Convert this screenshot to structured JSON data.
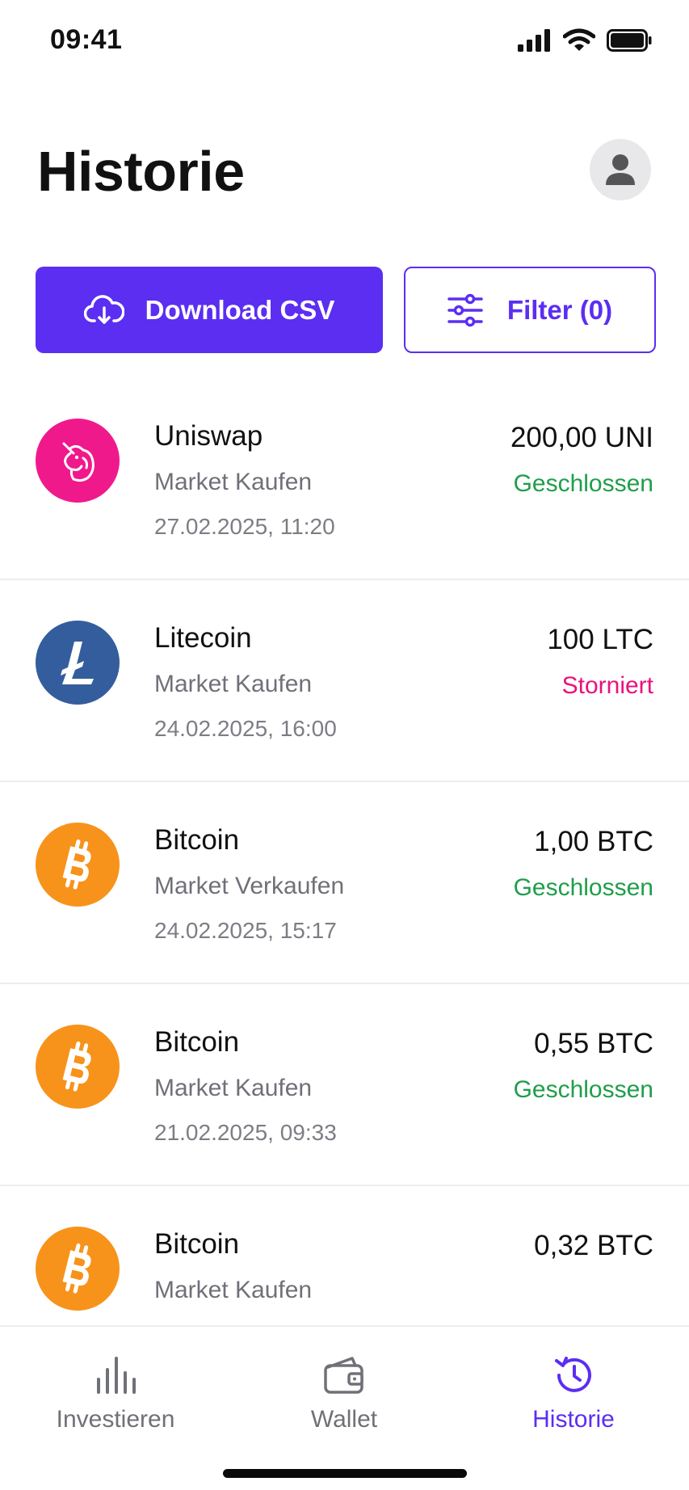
{
  "status_bar": {
    "time": "09:41"
  },
  "header": {
    "title": "Historie"
  },
  "actions": {
    "download_label": "Download CSV",
    "filter_label": "Filter (0)"
  },
  "colors": {
    "accent": "#5b2ef2",
    "status_closed": "#1f9e4a",
    "status_cancelled": "#e8127c",
    "uniswap": "#f0198c",
    "litecoin": "#345d9d",
    "bitcoin": "#f7931a"
  },
  "transactions": [
    {
      "coin": "uniswap",
      "icon": "uniswap-icon",
      "name": "Uniswap",
      "type": "Market Kaufen",
      "date": "27.02.2025, 11:20",
      "amount": "200,00 UNI",
      "status": "Geschlossen",
      "status_kind": "closed"
    },
    {
      "coin": "litecoin",
      "icon": "litecoin-icon",
      "name": "Litecoin",
      "type": "Market Kaufen",
      "date": "24.02.2025, 16:00",
      "amount": "100 LTC",
      "status": "Storniert",
      "status_kind": "cancelled"
    },
    {
      "coin": "bitcoin",
      "icon": "bitcoin-icon",
      "name": "Bitcoin",
      "type": "Market Verkaufen",
      "date": "24.02.2025, 15:17",
      "amount": "1,00 BTC",
      "status": "Geschlossen",
      "status_kind": "closed"
    },
    {
      "coin": "bitcoin",
      "icon": "bitcoin-icon",
      "name": "Bitcoin",
      "type": "Market Kaufen",
      "date": "21.02.2025, 09:33",
      "amount": "0,55 BTC",
      "status": "Geschlossen",
      "status_kind": "closed"
    },
    {
      "coin": "bitcoin",
      "icon": "bitcoin-icon",
      "name": "Bitcoin",
      "type": "Market Kaufen",
      "date": "",
      "amount": "0,32 BTC",
      "status": "",
      "status_kind": ""
    }
  ],
  "bottom_nav": {
    "items": [
      {
        "label": "Investieren",
        "icon": "bar-chart-icon"
      },
      {
        "label": "Wallet",
        "icon": "wallet-icon"
      },
      {
        "label": "Historie",
        "icon": "history-icon",
        "active": true
      }
    ]
  }
}
